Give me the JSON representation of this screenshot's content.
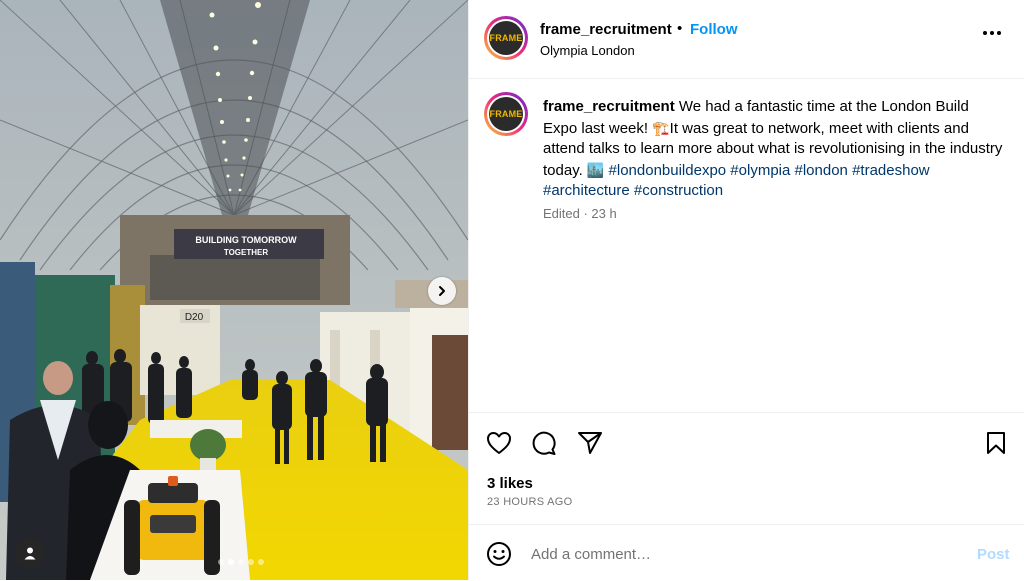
{
  "header": {
    "username": "frame_recruitment",
    "separator": "•",
    "follow_label": "Follow",
    "location": "Olympia London",
    "avatar_logo_text": "FRAME",
    "more_icon": "more-horizontal-icon"
  },
  "photo": {
    "banner_line1": "BUILDING TOMORROW",
    "banner_line2": "TOGETHER",
    "stand_label": "D20",
    "carousel_total": 5,
    "carousel_active": 2,
    "next_icon": "chevron-right-icon",
    "tag_icon": "user-tag-icon"
  },
  "caption": {
    "username": "frame_recruitment",
    "text_part1": " We had a fantastic time at the London Build Expo last week! ",
    "emoji1": "🏗️",
    "text_part2": "It was great to network, meet with clients and attend talks to learn more about what is revolutionising in the industry today. ",
    "emoji2": "🏙️",
    "hashtags": [
      " #londonbuildexpo",
      " #olympia",
      " #london",
      " #tradeshow",
      " #architecture",
      " #construction"
    ],
    "edited": "Edited · 23 h"
  },
  "actions": {
    "like_icon": "heart-icon",
    "comment_icon": "comment-icon",
    "share_icon": "send-icon",
    "save_icon": "bookmark-icon",
    "likes": "3 likes",
    "time": "23 HOURS AGO"
  },
  "comment": {
    "emoji_icon": "smiley-icon",
    "placeholder": "Add a comment…",
    "post_label": "Post"
  },
  "colors": {
    "accent": "#0095f6",
    "hashtag": "#00376b",
    "muted": "#737373",
    "post_disabled": "#b3dbff",
    "floor_yellow": "#f2d500"
  }
}
